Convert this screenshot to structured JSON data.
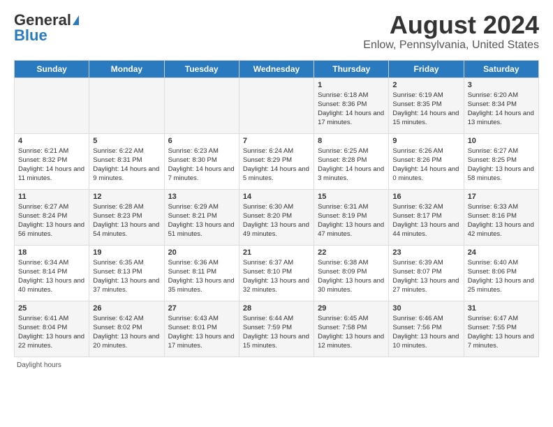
{
  "logo": {
    "text_general": "General",
    "text_blue": "Blue"
  },
  "title": "August 2024",
  "subtitle": "Enlow, Pennsylvania, United States",
  "days_of_week": [
    "Sunday",
    "Monday",
    "Tuesday",
    "Wednesday",
    "Thursday",
    "Friday",
    "Saturday"
  ],
  "weeks": [
    [
      {
        "num": "",
        "info": ""
      },
      {
        "num": "",
        "info": ""
      },
      {
        "num": "",
        "info": ""
      },
      {
        "num": "",
        "info": ""
      },
      {
        "num": "1",
        "info": "Sunrise: 6:18 AM\nSunset: 8:36 PM\nDaylight: 14 hours and 17 minutes."
      },
      {
        "num": "2",
        "info": "Sunrise: 6:19 AM\nSunset: 8:35 PM\nDaylight: 14 hours and 15 minutes."
      },
      {
        "num": "3",
        "info": "Sunrise: 6:20 AM\nSunset: 8:34 PM\nDaylight: 14 hours and 13 minutes."
      }
    ],
    [
      {
        "num": "4",
        "info": "Sunrise: 6:21 AM\nSunset: 8:32 PM\nDaylight: 14 hours and 11 minutes."
      },
      {
        "num": "5",
        "info": "Sunrise: 6:22 AM\nSunset: 8:31 PM\nDaylight: 14 hours and 9 minutes."
      },
      {
        "num": "6",
        "info": "Sunrise: 6:23 AM\nSunset: 8:30 PM\nDaylight: 14 hours and 7 minutes."
      },
      {
        "num": "7",
        "info": "Sunrise: 6:24 AM\nSunset: 8:29 PM\nDaylight: 14 hours and 5 minutes."
      },
      {
        "num": "8",
        "info": "Sunrise: 6:25 AM\nSunset: 8:28 PM\nDaylight: 14 hours and 3 minutes."
      },
      {
        "num": "9",
        "info": "Sunrise: 6:26 AM\nSunset: 8:26 PM\nDaylight: 14 hours and 0 minutes."
      },
      {
        "num": "10",
        "info": "Sunrise: 6:27 AM\nSunset: 8:25 PM\nDaylight: 13 hours and 58 minutes."
      }
    ],
    [
      {
        "num": "11",
        "info": "Sunrise: 6:27 AM\nSunset: 8:24 PM\nDaylight: 13 hours and 56 minutes."
      },
      {
        "num": "12",
        "info": "Sunrise: 6:28 AM\nSunset: 8:23 PM\nDaylight: 13 hours and 54 minutes."
      },
      {
        "num": "13",
        "info": "Sunrise: 6:29 AM\nSunset: 8:21 PM\nDaylight: 13 hours and 51 minutes."
      },
      {
        "num": "14",
        "info": "Sunrise: 6:30 AM\nSunset: 8:20 PM\nDaylight: 13 hours and 49 minutes."
      },
      {
        "num": "15",
        "info": "Sunrise: 6:31 AM\nSunset: 8:19 PM\nDaylight: 13 hours and 47 minutes."
      },
      {
        "num": "16",
        "info": "Sunrise: 6:32 AM\nSunset: 8:17 PM\nDaylight: 13 hours and 44 minutes."
      },
      {
        "num": "17",
        "info": "Sunrise: 6:33 AM\nSunset: 8:16 PM\nDaylight: 13 hours and 42 minutes."
      }
    ],
    [
      {
        "num": "18",
        "info": "Sunrise: 6:34 AM\nSunset: 8:14 PM\nDaylight: 13 hours and 40 minutes."
      },
      {
        "num": "19",
        "info": "Sunrise: 6:35 AM\nSunset: 8:13 PM\nDaylight: 13 hours and 37 minutes."
      },
      {
        "num": "20",
        "info": "Sunrise: 6:36 AM\nSunset: 8:11 PM\nDaylight: 13 hours and 35 minutes."
      },
      {
        "num": "21",
        "info": "Sunrise: 6:37 AM\nSunset: 8:10 PM\nDaylight: 13 hours and 32 minutes."
      },
      {
        "num": "22",
        "info": "Sunrise: 6:38 AM\nSunset: 8:09 PM\nDaylight: 13 hours and 30 minutes."
      },
      {
        "num": "23",
        "info": "Sunrise: 6:39 AM\nSunset: 8:07 PM\nDaylight: 13 hours and 27 minutes."
      },
      {
        "num": "24",
        "info": "Sunrise: 6:40 AM\nSunset: 8:06 PM\nDaylight: 13 hours and 25 minutes."
      }
    ],
    [
      {
        "num": "25",
        "info": "Sunrise: 6:41 AM\nSunset: 8:04 PM\nDaylight: 13 hours and 22 minutes."
      },
      {
        "num": "26",
        "info": "Sunrise: 6:42 AM\nSunset: 8:02 PM\nDaylight: 13 hours and 20 minutes."
      },
      {
        "num": "27",
        "info": "Sunrise: 6:43 AM\nSunset: 8:01 PM\nDaylight: 13 hours and 17 minutes."
      },
      {
        "num": "28",
        "info": "Sunrise: 6:44 AM\nSunset: 7:59 PM\nDaylight: 13 hours and 15 minutes."
      },
      {
        "num": "29",
        "info": "Sunrise: 6:45 AM\nSunset: 7:58 PM\nDaylight: 13 hours and 12 minutes."
      },
      {
        "num": "30",
        "info": "Sunrise: 6:46 AM\nSunset: 7:56 PM\nDaylight: 13 hours and 10 minutes."
      },
      {
        "num": "31",
        "info": "Sunrise: 6:47 AM\nSunset: 7:55 PM\nDaylight: 13 hours and 7 minutes."
      }
    ]
  ],
  "footer": "Daylight hours"
}
